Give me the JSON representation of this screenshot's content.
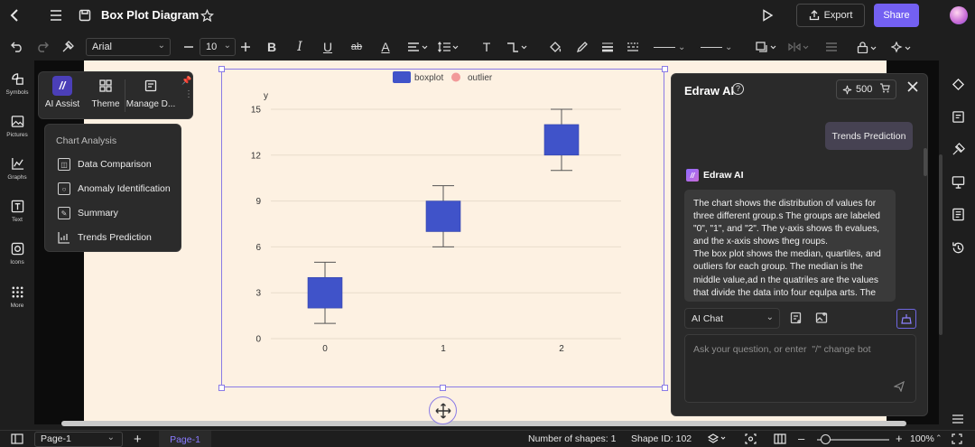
{
  "topbar": {
    "title": "Box Plot Diagram",
    "export_label": "Export",
    "share_label": "Share",
    "accent_color": "#7360f2"
  },
  "toolbar": {
    "font_family": "Arial",
    "font_size": "10",
    "bold_glyph": "B",
    "italic_glyph": "I",
    "underline_glyph": "U",
    "strike_glyph": "ab",
    "text_color_glyph": "A",
    "text_glyph": "T"
  },
  "leftbar": {
    "items": [
      {
        "label": "Symbols",
        "icon": "symbols-icon"
      },
      {
        "label": "Pictures",
        "icon": "pictures-icon"
      },
      {
        "label": "Graphs",
        "icon": "graphs-icon"
      },
      {
        "label": "Text",
        "icon": "text-icon"
      },
      {
        "label": "Icons",
        "icon": "icons-icon"
      },
      {
        "label": "More",
        "icon": "more-icon"
      }
    ]
  },
  "ai_toolbar": {
    "items": [
      {
        "label": "AI Assist",
        "icon": "ai-assist-icon"
      },
      {
        "label": "Theme",
        "icon": "theme-icon"
      },
      {
        "label": "Manage D...",
        "icon": "manage-data-icon"
      }
    ]
  },
  "chart_menu": {
    "header": "Chart Analysis",
    "items": [
      {
        "label": "Data Comparison",
        "icon": "data-comparison-icon"
      },
      {
        "label": "Anomaly Identification",
        "icon": "anomaly-icon"
      },
      {
        "label": "Summary",
        "icon": "summary-icon"
      },
      {
        "label": "Trends Prediction",
        "icon": "trends-icon"
      }
    ]
  },
  "chart_data": {
    "type": "box",
    "ylabel": "y",
    "ylim": [
      0,
      15
    ],
    "yticks": [
      "0",
      "3",
      "6",
      "9",
      "12",
      "15"
    ],
    "categories": [
      "0",
      "1",
      "2"
    ],
    "legend": [
      "boxplot",
      "outlier"
    ],
    "series": [
      {
        "name": "boxplot",
        "color": "#4053c9",
        "boxes": [
          {
            "category": "0",
            "min": 1,
            "q1": 2,
            "q3": 4,
            "max": 5
          },
          {
            "category": "1",
            "min": 6,
            "q1": 7,
            "q3": 9,
            "max": 10
          },
          {
            "category": "2",
            "min": 11,
            "q1": 12,
            "q3": 14,
            "max": 15
          }
        ]
      },
      {
        "name": "outlier",
        "color": "#f29a9a",
        "points": []
      }
    ]
  },
  "ai_panel": {
    "title": "Edraw AI",
    "credits": "500",
    "user_message": "Trends Prediction",
    "bot_name": "Edraw AI",
    "bot_message": "The chart shows the distribution of values for three different group.s The groups are labeled \"0\", \"1\", and \"2\". The y-axis shows th evalues, and the x-axis shows theg roups.\nThe box plot shows the median, quartiles, and outliers for each group. The median is the middle value,ad n the quatriles are the values that divide the data into four equlpa arts. The",
    "mode_select": "AI Chat",
    "input_placeholder": "Ask your question, or enter  \"/\" change bot"
  },
  "statusbar": {
    "page_select": "Page-1",
    "page_tab": "Page-1",
    "shapes": "Number of shapes: 1",
    "shape_id": "Shape ID: 102",
    "zoom": "100%"
  }
}
